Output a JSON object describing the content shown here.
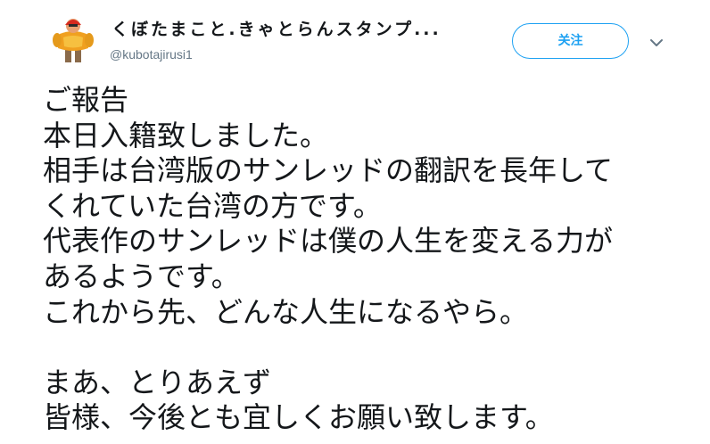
{
  "author": {
    "display_name": "くぼたまこと.きゃとらんスタンプ...",
    "handle": "@kubotajirusi1",
    "avatar_icon": "avatar-image"
  },
  "actions": {
    "follow_label": "关注",
    "more_icon": "chevron-down-icon"
  },
  "colors": {
    "accent": "#1da1f2",
    "text": "#14171a",
    "muted": "#657786"
  },
  "tweet": {
    "lines": [
      "ご報告",
      "本日入籍致しました。",
      "相手は台湾版のサンレッドの翻訳を長年して",
      "くれていた台湾の方です。",
      "代表作のサンレッドは僕の人生を変える力が",
      "あるようです。",
      "これから先、どんな人生になるやら。",
      "",
      "まあ、とりあえず",
      "皆様、今後とも宜しくお願い致します。"
    ]
  }
}
